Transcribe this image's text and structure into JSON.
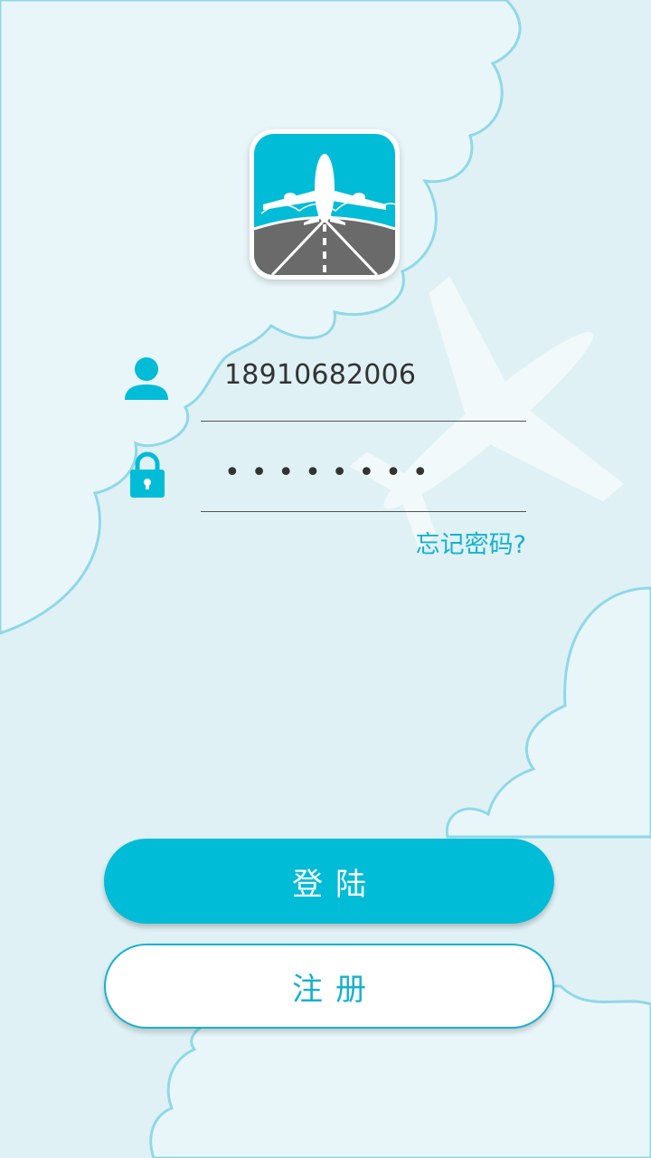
{
  "login_form": {
    "username_value": "18910682006",
    "password_mask": "••••••••",
    "forgot_password_label": "忘记密码?"
  },
  "actions": {
    "login_label": "登陆",
    "register_label": "注册"
  },
  "icons": {
    "app": "airplane-runway-app-icon",
    "user": "user-icon",
    "lock": "lock-icon",
    "background": "airplane-silhouette"
  },
  "colors": {
    "accent": "#00bcd6",
    "background": "#dff1f5",
    "cloud_outline": "#8fd8e8",
    "text": "#333333"
  }
}
